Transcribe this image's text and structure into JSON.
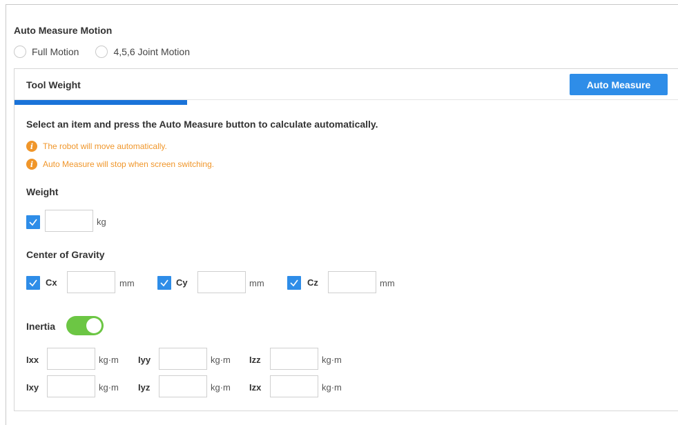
{
  "motion": {
    "title": "Auto Measure Motion",
    "options": [
      "Full Motion",
      "4,5,6 Joint Motion"
    ]
  },
  "tool": {
    "title": "Tool Weight",
    "auto_measure_label": "Auto Measure",
    "instruction": "Select an item and press the Auto Measure button to calculate automatically.",
    "notes": [
      "The robot will move automatically.",
      "Auto Measure will stop when screen switching."
    ],
    "weight": {
      "label": "Weight",
      "unit": "kg",
      "value": ""
    },
    "cog": {
      "label": "Center of Gravity",
      "items": [
        {
          "name": "Cx",
          "unit": "mm",
          "value": ""
        },
        {
          "name": "Cy",
          "unit": "mm",
          "value": ""
        },
        {
          "name": "Cz",
          "unit": "mm",
          "value": ""
        }
      ]
    },
    "inertia": {
      "label": "Inertia",
      "enabled": true,
      "row1": [
        {
          "name": "Ixx",
          "unit": "kg·m",
          "value": ""
        },
        {
          "name": "Iyy",
          "unit": "kg·m",
          "value": ""
        },
        {
          "name": "Izz",
          "unit": "kg·m",
          "value": ""
        }
      ],
      "row2": [
        {
          "name": "Ixy",
          "unit": "kg·m",
          "value": ""
        },
        {
          "name": "Iyz",
          "unit": "kg·m",
          "value": ""
        },
        {
          "name": "Izx",
          "unit": "kg·m",
          "value": ""
        }
      ]
    }
  },
  "colors": {
    "accent": "#2e8de8",
    "tab_underline": "#1a73d9",
    "warning": "#f0962a",
    "toggle_on": "#6cc644"
  }
}
